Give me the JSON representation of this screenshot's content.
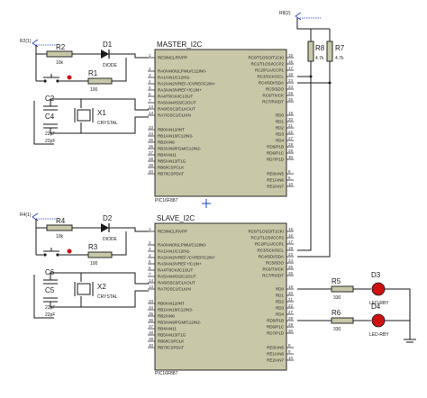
{
  "master": {
    "title": "MASTER_I2C",
    "part": "PIC16F887",
    "left_pins": [
      {
        "name": "RE3/MCLR/VPP",
        "num": "1"
      },
      {
        "name": "RA0/AN0/ULPWU/C12IN0-",
        "num": "2"
      },
      {
        "name": "RA1/AN1/C12IN1-",
        "num": "3"
      },
      {
        "name": "RA2/AN2/VREF-/CVREF/C2IN+",
        "num": "4"
      },
      {
        "name": "RA3/AN3/VREF+/C1IN+",
        "num": "5"
      },
      {
        "name": "RA4/T0CKI/C1OUT",
        "num": "6"
      },
      {
        "name": "RA5/AN4/SS/C2OUT",
        "num": "7"
      },
      {
        "name": "RA6/OSC2/CLKOUT",
        "num": "14"
      },
      {
        "name": "RA7/OSC1/CLKIN",
        "num": "13"
      },
      {
        "name": "RB0/AN12/INT",
        "num": "33"
      },
      {
        "name": "RB1/AN10/C12IN3-",
        "num": "34"
      },
      {
        "name": "RB2/AN8",
        "num": "35"
      },
      {
        "name": "RB3/AN9/PGM/C12IN2-",
        "num": "36"
      },
      {
        "name": "RB4/AN11",
        "num": "37"
      },
      {
        "name": "RB5/AN13/T1G",
        "num": "38"
      },
      {
        "name": "RB6/ICSPCLK",
        "num": "39"
      },
      {
        "name": "RB7/ICSPDAT",
        "num": "40"
      }
    ],
    "right_pins": [
      {
        "name": "RC0/T1OSO/T1CKI",
        "num": "15"
      },
      {
        "name": "RC1/T1OSI/CCP2",
        "num": "16"
      },
      {
        "name": "RC2/P1A/CCP1",
        "num": "17"
      },
      {
        "name": "RC3/SCK/SCL",
        "num": "18"
      },
      {
        "name": "RC4/SDI/SDA",
        "num": "23"
      },
      {
        "name": "RC5/SDO",
        "num": "24"
      },
      {
        "name": "RC6/TX/CK",
        "num": "25"
      },
      {
        "name": "RC7/RX/DT",
        "num": "26"
      },
      {
        "name": "RD0",
        "num": "19"
      },
      {
        "name": "RD1",
        "num": "20"
      },
      {
        "name": "RD2",
        "num": "21"
      },
      {
        "name": "RD3",
        "num": "22"
      },
      {
        "name": "RD4",
        "num": "27"
      },
      {
        "name": "RD5/P1B",
        "num": "28"
      },
      {
        "name": "RD6/P1C",
        "num": "29"
      },
      {
        "name": "RD7/P1D",
        "num": "30"
      },
      {
        "name": "RE0/AN5",
        "num": "8"
      },
      {
        "name": "RE1/AN6",
        "num": "9"
      },
      {
        "name": "RE2/AN7",
        "num": "10"
      }
    ]
  },
  "slave": {
    "title": "SLAVE_I2C",
    "part": "PIC16F887",
    "left_pins": [
      {
        "name": "RE3/MCLR/VPP",
        "num": "1"
      },
      {
        "name": "RA0/AN0/ULPWU/C12IN0-",
        "num": "2"
      },
      {
        "name": "RA1/AN1/C12IN1-",
        "num": "3"
      },
      {
        "name": "RA2/AN2/VREF-/CVREF/C2IN+",
        "num": "4"
      },
      {
        "name": "RA3/AN3/VREF+/C1IN+",
        "num": "5"
      },
      {
        "name": "RA4/T0CKI/C1OUT",
        "num": "6"
      },
      {
        "name": "RA5/AN4/SS/C2OUT",
        "num": "7"
      },
      {
        "name": "RA6/OSC2/CLKOUT",
        "num": "14"
      },
      {
        "name": "RA7/OSC1/CLKIN",
        "num": "13"
      },
      {
        "name": "RB0/AN12/INT",
        "num": "33"
      },
      {
        "name": "RB1/AN10/C12IN3-",
        "num": "34"
      },
      {
        "name": "RB2/AN8",
        "num": "35"
      },
      {
        "name": "RB3/AN9/PGM/C12IN2-",
        "num": "36"
      },
      {
        "name": "RB4/AN11",
        "num": "37"
      },
      {
        "name": "RB5/AN13/T1G",
        "num": "38"
      },
      {
        "name": "RB6/ICSPCLK",
        "num": "39"
      },
      {
        "name": "RB7/ICSPDAT",
        "num": "40"
      }
    ],
    "right_pins": [
      {
        "name": "RC0/T1OSO/T1CKI",
        "num": "15"
      },
      {
        "name": "RC1/T1OSI/CCP2",
        "num": "16"
      },
      {
        "name": "RC2/P1A/CCP1",
        "num": "17"
      },
      {
        "name": "RC3/SCK/SCL",
        "num": "18"
      },
      {
        "name": "RC4/SDI/SDA",
        "num": "23"
      },
      {
        "name": "RC5/SDO",
        "num": "24"
      },
      {
        "name": "RC6/TX/CK",
        "num": "25"
      },
      {
        "name": "RC7/RX/DT",
        "num": "26"
      },
      {
        "name": "RD0",
        "num": "19"
      },
      {
        "name": "RD1",
        "num": "20"
      },
      {
        "name": "RD2",
        "num": "21"
      },
      {
        "name": "RD3",
        "num": "22"
      },
      {
        "name": "RD4",
        "num": "27"
      },
      {
        "name": "RD5/P1B",
        "num": "28"
      },
      {
        "name": "RD6/P1C",
        "num": "29"
      },
      {
        "name": "RD7/P1D",
        "num": "30"
      },
      {
        "name": "RE0/AN5",
        "num": "8"
      },
      {
        "name": "RE1/AN6",
        "num": "9"
      },
      {
        "name": "RE2/AN7",
        "num": "10"
      }
    ]
  },
  "components": {
    "r1": {
      "ref": "R1",
      "val": "100"
    },
    "r2": {
      "ref": "R2",
      "val": "10k"
    },
    "r3": {
      "ref": "R3",
      "val": "100"
    },
    "r4": {
      "ref": "R4",
      "val": "10k"
    },
    "r5": {
      "ref": "R5",
      "val": "330"
    },
    "r6": {
      "ref": "R6",
      "val": "330"
    },
    "r7": {
      "ref": "R7",
      "val": "4.7k"
    },
    "r8": {
      "ref": "R8",
      "val": "4.7k"
    },
    "d1": {
      "ref": "D1",
      "val": "DIODE"
    },
    "d2": {
      "ref": "D2",
      "val": "DIODE"
    },
    "d3": {
      "ref": "D3",
      "val": "LED-RBY"
    },
    "d4": {
      "ref": "D4",
      "val": "LED-RBY"
    },
    "c2": {
      "ref": "C2",
      "val": "22pF"
    },
    "c4": {
      "ref": "C4",
      "val": "22pF"
    },
    "c5": {
      "ref": "C5",
      "val": "22pF"
    },
    "c6": {
      "ref": "C6",
      "val": "22pF"
    },
    "x1": {
      "ref": "X1",
      "val": "CRYSTAL"
    },
    "x2": {
      "ref": "X2",
      "val": "CRYSTAL"
    }
  },
  "power": {
    "r2_1": "R2(1)",
    "r4_1": "R4(1)",
    "r8_2": "R8(2)"
  },
  "colors": {
    "chip_fill": "#c8c8a8",
    "led": "#cc1111",
    "wire": "#1a1a1a"
  }
}
